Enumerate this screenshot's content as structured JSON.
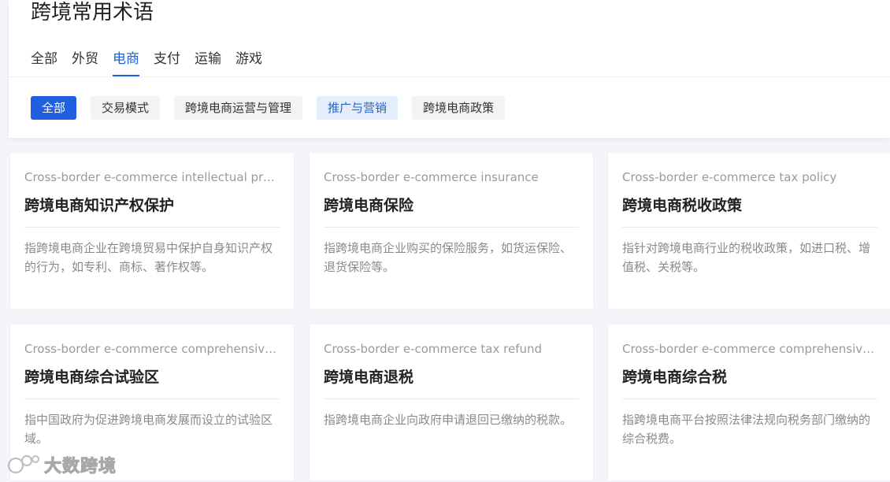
{
  "page": {
    "title": "跨境常用术语"
  },
  "tabs": [
    {
      "label": "全部",
      "active": false
    },
    {
      "label": "外贸",
      "active": false
    },
    {
      "label": "电商",
      "active": true
    },
    {
      "label": "支付",
      "active": false
    },
    {
      "label": "运输",
      "active": false
    },
    {
      "label": "游戏",
      "active": false
    }
  ],
  "chips": [
    {
      "label": "全部",
      "state": "selected"
    },
    {
      "label": "交易模式",
      "state": "normal"
    },
    {
      "label": "跨境电商运营与管理",
      "state": "normal"
    },
    {
      "label": "推广与营销",
      "state": "highlight"
    },
    {
      "label": "跨境电商政策",
      "state": "normal"
    }
  ],
  "cards": [
    {
      "en": "Cross-border e-commerce intellectual property protection",
      "zh": "跨境电商知识产权保护",
      "desc": "指跨境电商企业在跨境贸易中保护自身知识产权的行为，如专利、商标、著作权等。"
    },
    {
      "en": "Cross-border e-commerce insurance",
      "zh": "跨境电商保险",
      "desc": "指跨境电商企业购买的保险服务，如货运保险、退货保险等。"
    },
    {
      "en": "Cross-border e-commerce tax policy",
      "zh": "跨境电商税收政策",
      "desc": "指针对跨境电商行业的税收政策，如进口税、增值税、关税等。"
    },
    {
      "en": "Cross-border e-commerce comprehensive test zone",
      "zh": "跨境电商综合试验区",
      "desc": "指中国政府为促进跨境电商发展而设立的试验区域。"
    },
    {
      "en": "Cross-border e-commerce tax refund",
      "zh": "跨境电商退税",
      "desc": "指跨境电商企业向政府申请退回已缴纳的税款。"
    },
    {
      "en": "Cross-border e-commerce comprehensive tax",
      "zh": "跨境电商综合税",
      "desc": "指跨境电商平台按照法律法规向税务部门缴纳的综合税费。"
    }
  ],
  "watermark": {
    "text": "大数跨境"
  },
  "colors": {
    "accent": "#1f5fe0",
    "highlight_bg": "#e3edfc",
    "page_bg": "#f3f5f9"
  }
}
